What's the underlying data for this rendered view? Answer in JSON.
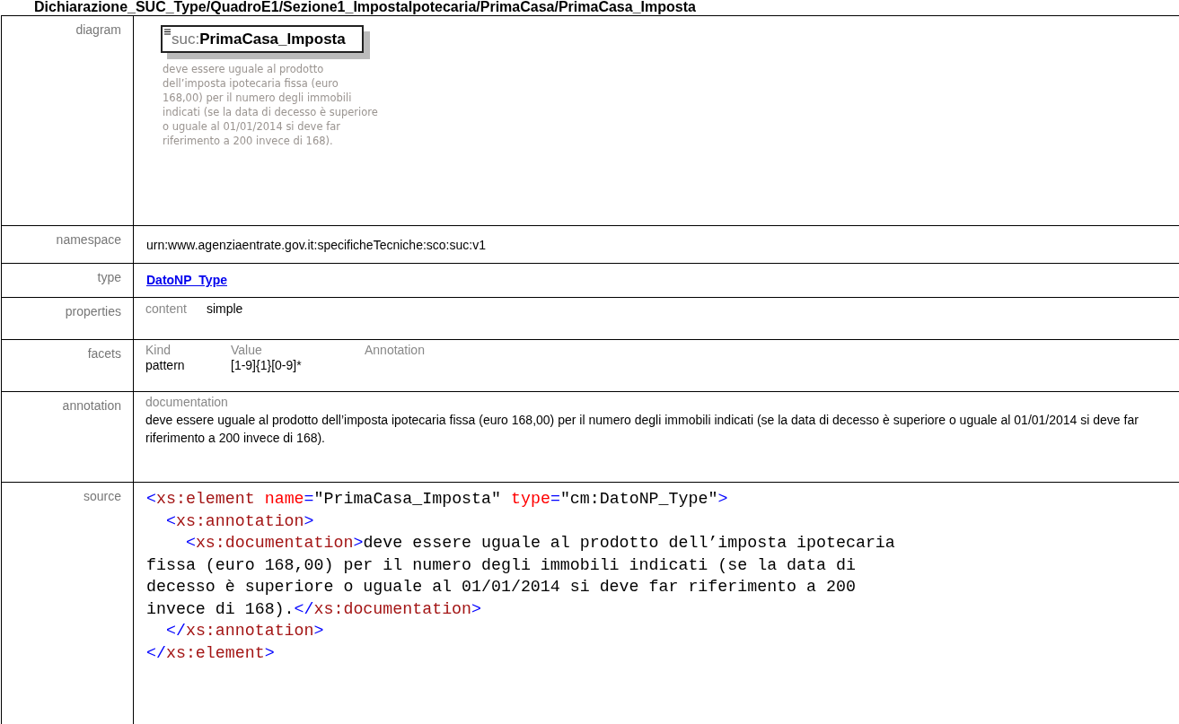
{
  "title": "Dichiarazione_SUC_Type/QuadroE1/Sezione1_ImpostaIpotecaria/PrimaCasa/PrimaCasa_Imposta",
  "rows": [
    {
      "kind": "diagram",
      "label": "diagram",
      "prefix": "suc:",
      "name": "PrimaCasa_Imposta",
      "description": "deve essere uguale al prodotto dell’imposta ipotecaria fissa (euro 168,00) per il numero degli immobili indicati (se la data di decesso è superiore o uguale al 01/01/2014 si deve far riferimento a 200 invece di 168)."
    },
    {
      "kind": "text",
      "label": "namespace",
      "value": "urn:www.agenziaentrate.gov.it:specificheTecniche:sco:suc:v1"
    },
    {
      "kind": "link",
      "label": "type",
      "value": "DatoNP_Type"
    },
    {
      "kind": "properties",
      "label": "properties",
      "items": [
        {
          "key": "content",
          "value": "simple"
        }
      ]
    },
    {
      "kind": "facets",
      "label": "facets",
      "columns": [
        "Kind",
        "Value",
        "Annotation"
      ],
      "rows": [
        [
          "pattern",
          "[1-9]{1}[0-9]*"
        ]
      ]
    },
    {
      "kind": "annotation",
      "label": "annotation",
      "heading": "documentation",
      "text": "deve essere uguale al prodotto dell’imposta ipotecaria fissa (euro 168,00) per il numero degli immobili indicati (se la data di decesso è superiore o uguale al 01/01/2014 si deve far riferimento a 200 invece di 168)."
    },
    {
      "kind": "source",
      "label": "source",
      "lines": [
        {
          "text": "<xs:element name=\"PrimaCasa_Imposta\" type=\"cm:DatoNP_Type\">"
        },
        {
          "text": "  <xs:annotation>"
        },
        {
          "text": "    <xs:documentation>deve essere uguale al prodotto dell’imposta ipotecaria"
        },
        {
          "text": "fissa (euro 168,00) per il numero degli immobili indicati (se la data di"
        },
        {
          "text": "decesso è superiore o uguale al 01/01/2014 si deve far riferimento a 200"
        },
        {
          "text": "invece di 168).</xs:documentation>"
        },
        {
          "text": "  </xs:annotation>"
        },
        {
          "text": "</xs:element>"
        }
      ]
    }
  ]
}
